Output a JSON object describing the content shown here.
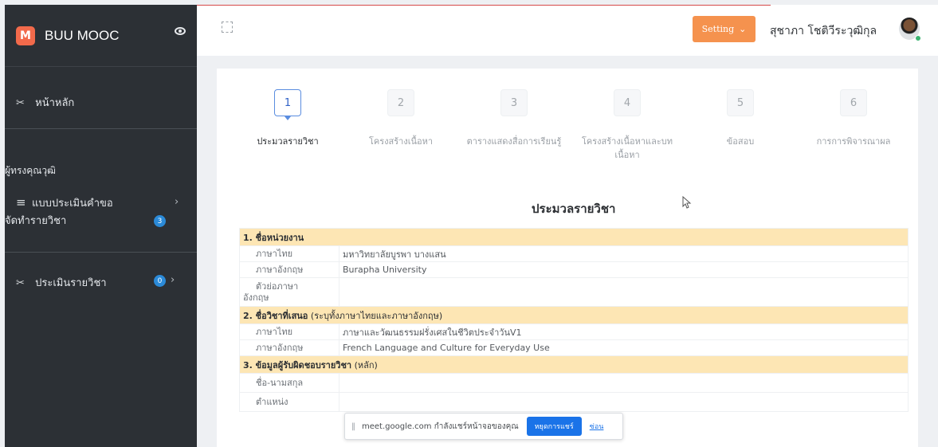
{
  "sidebar": {
    "brand": "BUU MOOC",
    "logo_letter": "M",
    "items": [
      {
        "label": "หน้าหลัก",
        "icon": "scissors-icon"
      },
      {
        "section": "ผู้ทรงคุณวุฒิ"
      },
      {
        "label_line1": "แบบประเมินคำขอ",
        "label_line2": "จัดทำรายวิชา",
        "icon": "menu-icon",
        "badge": "3"
      },
      {
        "label": "ประเมินรายวิชา",
        "icon": "scissors-icon",
        "badge": "0"
      }
    ]
  },
  "topbar": {
    "setting_label": "Setting",
    "user_name": "สุชาภา โชติวีระวุฒิกุล"
  },
  "steps": [
    {
      "num": "1",
      "label": "ประมวลรายวิชา",
      "active": true
    },
    {
      "num": "2",
      "label": "โครงสร้างเนื้อหา"
    },
    {
      "num": "3",
      "label": "ตารางแสดงสื่อการเรียนรู้"
    },
    {
      "num": "4",
      "label_line1": "โครงสร้างเนื้อหาและบท",
      "label_line2": "เนื้อหา"
    },
    {
      "num": "5",
      "label": "ข้อสอบ"
    },
    {
      "num": "6",
      "label": "การการพิจารณาผล"
    }
  ],
  "content": {
    "title": "ประมวลรายวิชา",
    "sections": [
      {
        "header": "1. ชื่อหน่วยงาน",
        "rows": [
          {
            "key": "ภาษาไทย",
            "value": "มหาวิทยาลัยบูรพา บางแสน"
          },
          {
            "key": "ภาษาอังกฤษ",
            "value": "Burapha University"
          },
          {
            "key_line1": "ตัวย่อภาษา",
            "key_line2": "อังกฤษ",
            "value": ""
          }
        ]
      },
      {
        "header": "2. ชื่อวิชาที่เสนอ",
        "header_note": "(ระบุทั้งภาษาไทยและภาษาอังกฤษ)",
        "rows": [
          {
            "key": "ภาษาไทย",
            "value": "ภาษาและวัฒนธรรมฝรั่งเศสในชีวิตประจำวันV1"
          },
          {
            "key": "ภาษาอังกฤษ",
            "value": "French Language and Culture for Everyday Use"
          }
        ]
      },
      {
        "header": "3. ข้อมูลผู้รับผิดชอบรายวิชา",
        "header_note": "(หลัก)",
        "rows": [
          {
            "key": "ชื่อ-นามสกุล",
            "value": ""
          },
          {
            "key": "ตำแหน่ง",
            "value": ""
          }
        ]
      }
    ]
  },
  "meet_bar": {
    "text": "meet.google.com กำลังแชร์หน้าจอของคุณ",
    "stop_label": "หยุดการแชร์",
    "hide_label": "ซ่อน"
  }
}
